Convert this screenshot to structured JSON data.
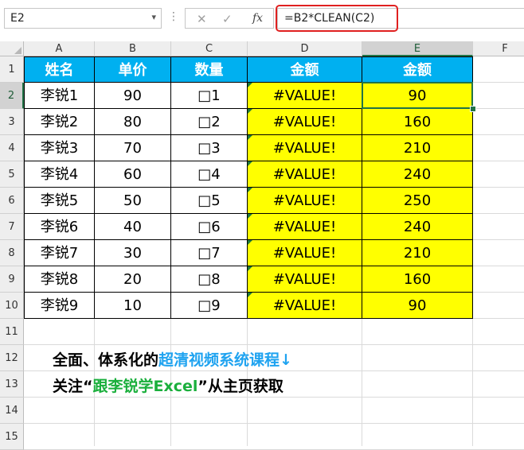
{
  "formula_bar": {
    "name_box": "E2",
    "name_box_caret": "▾",
    "dots": "⋮",
    "cancel_glyph": "✕",
    "enter_glyph": "✓",
    "fx_label": "fx",
    "formula": "=B2*CLEAN(C2)"
  },
  "columns": [
    "A",
    "B",
    "C",
    "D",
    "E",
    "F"
  ],
  "rows": [
    "1",
    "2",
    "3",
    "4",
    "5",
    "6",
    "7",
    "8",
    "9",
    "10",
    "11",
    "12",
    "13",
    "14",
    "15"
  ],
  "table": {
    "headers": [
      "姓名",
      "单价",
      "数量",
      "金额",
      "金额"
    ],
    "rows": [
      [
        "李锐1",
        "90",
        "□1",
        "#VALUE!",
        "90"
      ],
      [
        "李锐2",
        "80",
        "□2",
        "#VALUE!",
        "160"
      ],
      [
        "李锐3",
        "70",
        "□3",
        "#VALUE!",
        "210"
      ],
      [
        "李锐4",
        "60",
        "□4",
        "#VALUE!",
        "240"
      ],
      [
        "李锐5",
        "50",
        "□5",
        "#VALUE!",
        "250"
      ],
      [
        "李锐6",
        "40",
        "□6",
        "#VALUE!",
        "240"
      ],
      [
        "李锐7",
        "30",
        "□7",
        "#VALUE!",
        "210"
      ],
      [
        "李锐8",
        "20",
        "□8",
        "#VALUE!",
        "160"
      ],
      [
        "李锐9",
        "10",
        "□9",
        "#VALUE!",
        "90"
      ]
    ]
  },
  "notes": {
    "line1_prefix": "全面、体系化的",
    "line1_highlight": "超清视频系统课程↓",
    "line2_prefix": "关注“",
    "line2_highlight": "跟李锐学Excel",
    "line2_suffix": "”从主页获取"
  },
  "colors": {
    "header_fill": "#00b0f0",
    "highlight_fill": "#ffff00",
    "selection": "#217346",
    "formula_box": "#e02020"
  },
  "selected_cell": "E2"
}
